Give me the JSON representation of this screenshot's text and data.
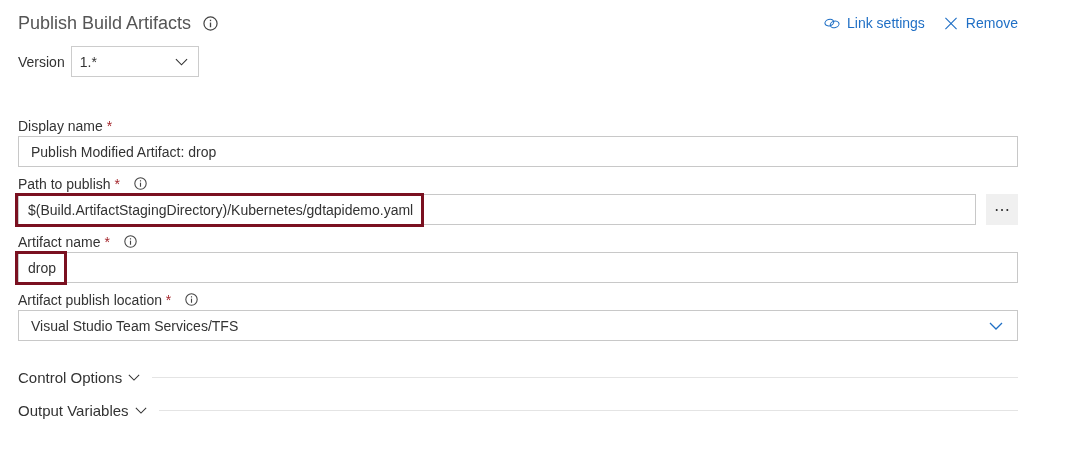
{
  "header": {
    "title": "Publish Build Artifacts",
    "actions": [
      {
        "kind": "link",
        "label": "Link settings"
      },
      {
        "kind": "remove",
        "label": "Remove"
      }
    ]
  },
  "version": {
    "label": "Version",
    "value": "1.*"
  },
  "fields": [
    {
      "kind": "text",
      "label": "Display name *",
      "info": false,
      "value": "Publish Modified Artifact: drop",
      "highlighted": false
    },
    {
      "kind": "browse",
      "label": "Path to publish *",
      "info": true,
      "value": "$(Build.ArtifactStagingDirectory)/Kubernetes/gdtapidemo.yaml",
      "highlighted": true,
      "button": "⋯"
    },
    {
      "kind": "text",
      "label": "Artifact name *",
      "info": true,
      "value": "drop",
      "highlighted": true
    },
    {
      "kind": "dropdown",
      "label": "Artifact publish location *",
      "info": true,
      "value": "Visual Studio Team Services/TFS",
      "highlighted": false
    }
  ],
  "sections": [
    {
      "label": "Control Options",
      "expanded": false
    },
    {
      "label": "Output Variables",
      "expanded": false
    }
  ]
}
